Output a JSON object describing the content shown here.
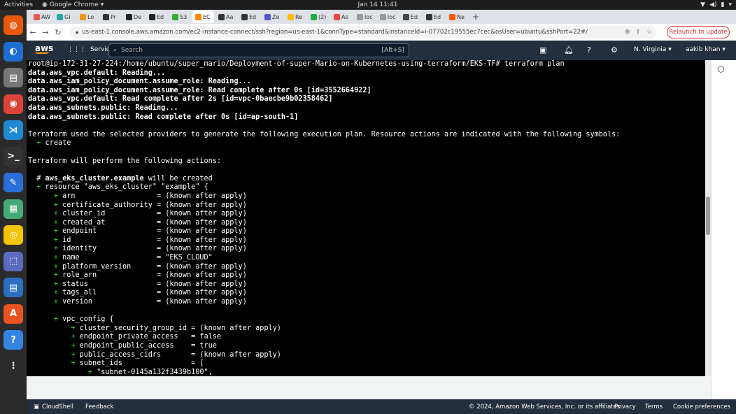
{
  "topbar": {
    "activities": "Activities",
    "app": "Google Chrome",
    "clock": "Jan 14  11:41"
  },
  "dock": {
    "icons": [
      "firefox-icon",
      "thunderbird-icon",
      "files-icon",
      "chrome-icon",
      "vscode-icon",
      "terminal-icon",
      "text-editor-icon",
      "screenshot-icon",
      "rhythmbox-icon",
      "screen-capture-icon",
      "writer-icon",
      "app-center-icon",
      "help-icon",
      "apps-grid-icon"
    ]
  },
  "tabs": [
    {
      "label": "AW",
      "color": "#e55"
    },
    {
      "label": "Gi",
      "color": "#2aa"
    },
    {
      "label": "Lo",
      "color": "#e91"
    },
    {
      "label": "Pr",
      "color": "#333"
    },
    {
      "label": "De",
      "color": "#222"
    },
    {
      "label": "Ed",
      "color": "#222"
    },
    {
      "label": "S3",
      "color": "#3a3"
    },
    {
      "label": "EC",
      "color": "#f80"
    },
    {
      "label": "Aa",
      "color": "#333"
    },
    {
      "label": "Ed",
      "color": "#333"
    },
    {
      "label": "Ze",
      "color": "#55c"
    },
    {
      "label": "Re",
      "color": "#fb0"
    },
    {
      "label": "(2)",
      "color": "#2a4"
    },
    {
      "label": "As",
      "color": "#e44"
    },
    {
      "label": "loc",
      "color": "#999"
    },
    {
      "label": "loc",
      "color": "#999"
    },
    {
      "label": "Ed",
      "color": "#444"
    },
    {
      "label": "Ed",
      "color": "#333"
    },
    {
      "label": "Ne",
      "color": "#f50"
    }
  ],
  "address": {
    "url": "us-east-1.console.aws.amazon.com/ec2-instance-connect/ssh?region=us-east-1&connType=standard&instanceId=i-07702c19555ec7cec&osUser=ubuntu&sshPort=22#/",
    "relaunch": "Relaunch to update"
  },
  "aws": {
    "logo": "aws",
    "services": "Services",
    "search_placeholder": "Search",
    "search_shortcut": "[Alt+S]",
    "region": "N. Virginia ▾",
    "user": "aakib khan ▾"
  },
  "terminal": {
    "lines": [
      {
        "t": "root@ip-172-31-27-224:/home/ubuntu/super_mario/Deployment-of-super-Mario-on-Kubernetes-using-terraform/EKS-TF# terraform plan",
        "s": ""
      },
      {
        "t": "data.aws_vpc.default: Reading...",
        "s": "b"
      },
      {
        "t": "data.aws_iam_policy_document.assume_role: Reading...",
        "s": "b"
      },
      {
        "t": "data.aws_iam_policy_document.assume_role: Read complete after 0s [id=3552664922]",
        "s": "b"
      },
      {
        "t": "data.aws_vpc.default: Read complete after 2s [id=vpc-0baecbe9b02358462]",
        "s": "b"
      },
      {
        "t": "data.aws_subnets.public: Reading...",
        "s": "b"
      },
      {
        "t": "data.aws_subnets.public: Read complete after 0s [id=ap-south-1]",
        "s": "b"
      },
      {
        "t": "",
        "s": ""
      },
      {
        "t": "Terraform used the selected providers to generate the following execution plan. Resource actions are indicated with the following symbols:",
        "s": ""
      },
      {
        "p": "  ",
        "g": "+",
        "t": " create"
      },
      {
        "t": "",
        "s": ""
      },
      {
        "t": "Terraform will perform the following actions:",
        "s": ""
      },
      {
        "t": "",
        "s": ""
      },
      {
        "p": "  # ",
        "bold": "aws_eks_cluster.example",
        "t": " will be created"
      },
      {
        "p": "  ",
        "g": "+",
        "t": " resource \"aws_eks_cluster\" \"example\" {"
      },
      {
        "p": "      ",
        "g": "+",
        "t": " arn                   = (known after apply)"
      },
      {
        "p": "      ",
        "g": "+",
        "t": " certificate_authority = (known after apply)"
      },
      {
        "p": "      ",
        "g": "+",
        "t": " cluster_id            = (known after apply)"
      },
      {
        "p": "      ",
        "g": "+",
        "t": " created_at            = (known after apply)"
      },
      {
        "p": "      ",
        "g": "+",
        "t": " endpoint              = (known after apply)"
      },
      {
        "p": "      ",
        "g": "+",
        "t": " id                    = (known after apply)"
      },
      {
        "p": "      ",
        "g": "+",
        "t": " identity              = (known after apply)"
      },
      {
        "p": "      ",
        "g": "+",
        "t": " name                  = \"EKS_CLOUD\""
      },
      {
        "p": "      ",
        "g": "+",
        "t": " platform_version      = (known after apply)"
      },
      {
        "p": "      ",
        "g": "+",
        "t": " role_arn              = (known after apply)"
      },
      {
        "p": "      ",
        "g": "+",
        "t": " status                = (known after apply)"
      },
      {
        "p": "      ",
        "g": "+",
        "t": " tags_all              = (known after apply)"
      },
      {
        "p": "      ",
        "g": "+",
        "t": " version               = (known after apply)"
      },
      {
        "t": "",
        "s": ""
      },
      {
        "p": "      ",
        "g": "+",
        "t": " vpc_config {"
      },
      {
        "p": "          ",
        "g": "+",
        "t": " cluster_security_group_id = (known after apply)"
      },
      {
        "p": "          ",
        "g": "+",
        "t": " endpoint_private_access   = false"
      },
      {
        "p": "          ",
        "g": "+",
        "t": " endpoint_public_access    = true"
      },
      {
        "p": "          ",
        "g": "+",
        "t": " public_access_cidrs       = (known after apply)"
      },
      {
        "p": "          ",
        "g": "+",
        "t": " subnet_ids                = ["
      },
      {
        "p": "              ",
        "g": "+",
        "t": " \"subnet-0145a132f3439b100\","
      }
    ]
  },
  "footer": {
    "cloudshell": "CloudShell",
    "feedback": "Feedback",
    "copyright": "© 2024, Amazon Web Services, Inc. or its affiliates.",
    "privacy": "Privacy",
    "terms": "Terms",
    "cookies": "Cookie preferences"
  }
}
